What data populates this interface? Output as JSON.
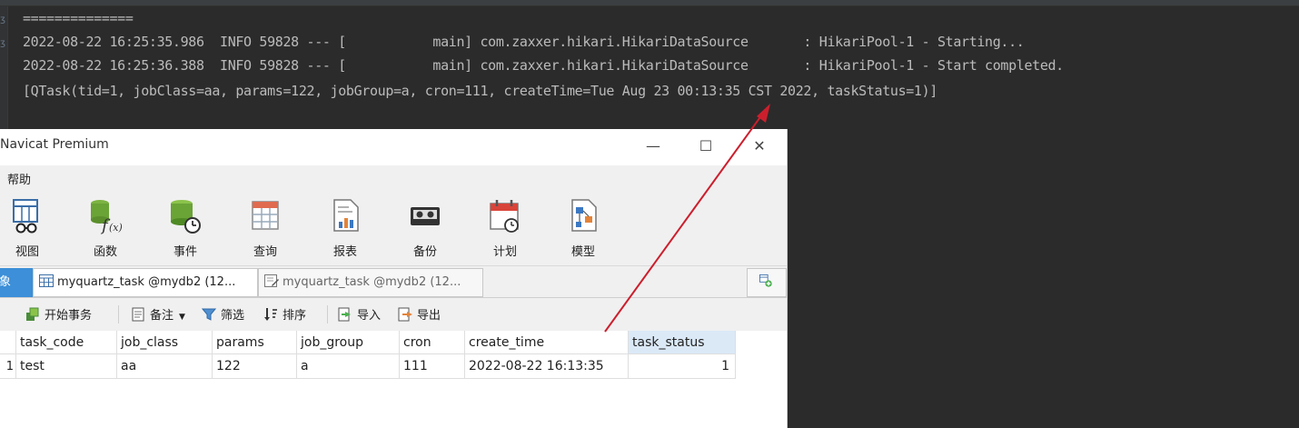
{
  "console": {
    "separator": "==============",
    "lines": [
      "2022-08-22 16:25:35.986  INFO 59828 --- [           main] com.zaxxer.hikari.HikariDataSource       : HikariPool-1 - Starting...",
      "2022-08-22 16:25:36.388  INFO 59828 --- [           main] com.zaxxer.hikari.HikariDataSource       : HikariPool-1 - Start completed.",
      "[QTask(tid=1, jobClass=aa, params=122, jobGroup=a, cron=111, createTime=Tue Aug 23 00:13:35 CST 2022, taskStatus=1)]"
    ]
  },
  "navicat": {
    "title": "Navicat Premium",
    "window_buttons": {
      "minimize": "—",
      "maximize": "☐",
      "close": "✕"
    },
    "menu": [
      "帮助"
    ],
    "ribbon": [
      {
        "label": "视图",
        "icon": "view-icon"
      },
      {
        "label": "函数",
        "icon": "function-icon"
      },
      {
        "label": "事件",
        "icon": "event-icon"
      },
      {
        "label": "查询",
        "icon": "query-icon"
      },
      {
        "label": "报表",
        "icon": "report-icon"
      },
      {
        "label": "备份",
        "icon": "backup-icon"
      },
      {
        "label": "计划",
        "icon": "schedule-icon"
      },
      {
        "label": "模型",
        "icon": "model-icon"
      }
    ],
    "tabs": [
      {
        "label": "象"
      },
      {
        "label": "myquartz_task @mydb2 (12..."
      },
      {
        "label": "myquartz_task @mydb2 (12..."
      }
    ],
    "toolbar": {
      "begin_transaction": "开始事务",
      "memo": "备注",
      "filter": "筛选",
      "sort": "排序",
      "import": "导入",
      "export": "导出"
    },
    "table": {
      "columns": [
        "task_code",
        "job_class",
        "params",
        "job_group",
        "cron",
        "create_time",
        "task_status"
      ],
      "rows": [
        {
          "rownum": "1",
          "cells": [
            "test",
            "aa",
            "122",
            "a",
            "111",
            "2022-08-22 16:13:35",
            "1"
          ]
        }
      ]
    }
  },
  "colors": {
    "console_bg": "#2b2b2b",
    "console_text": "#bbbbbb",
    "arrow": "#cc1f2d",
    "tab_active": "#3c8fd8"
  }
}
